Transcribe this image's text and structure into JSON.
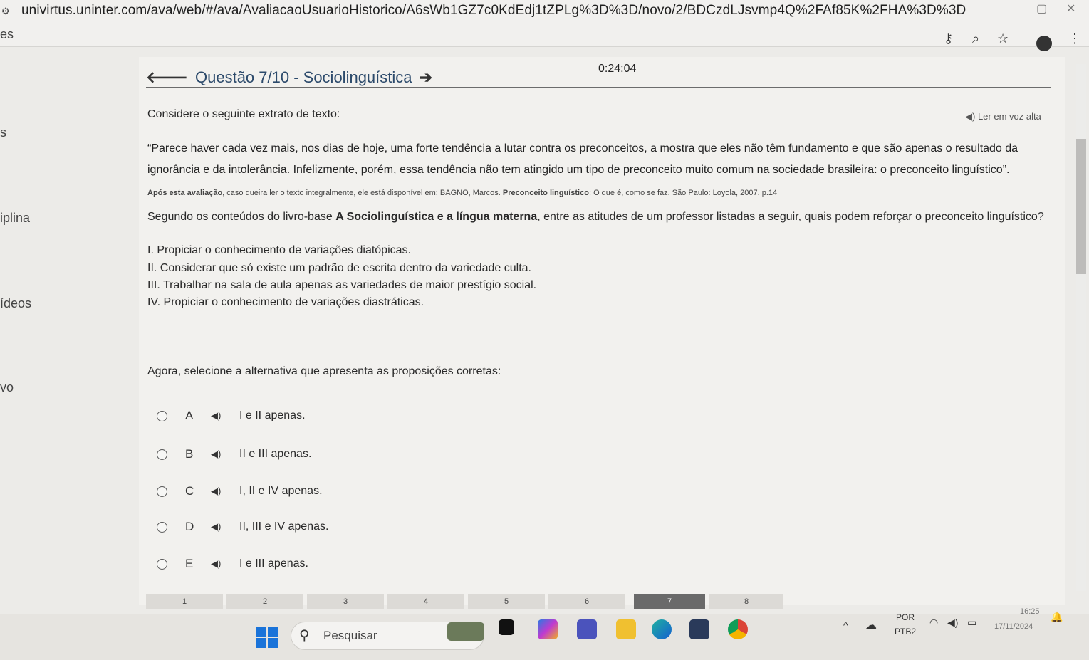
{
  "browser": {
    "url_line1": "univirtus.uninter.com/ava/web/#/ava/AvaliacaoUsuarioHistorico/A6sWb1GZ7c0KdEdj1tZPLg%3D%3D/novo/2/BDCzdLJsvmp4Q%2FAf85K%2FHA%3D%3D",
    "site_icon": "site-settings-icon",
    "toolbar_icons": [
      "password-key-icon",
      "zoom-icon",
      "bookmark-star-icon",
      "profile-avatar",
      "menu-kebab-icon"
    ]
  },
  "sidebar": {
    "fragments": [
      "es",
      "s",
      "iplina",
      "ídeos",
      "vo"
    ]
  },
  "exam": {
    "timer": "0:24:04",
    "title": "Questão 7/10 - Sociolinguística",
    "read_aloud": "Ler em voz alta",
    "prompt": "Considere o seguinte extrato de texto:",
    "quote_line1": "“Parece haver cada vez mais, nos dias de hoje, uma forte tendência a lutar contra os preconceitos, a mostra que eles não têm fundamento e que são apenas o resultado da",
    "quote_line2": "ignorância e da intolerância. Infelizmente, porém, essa tendência não tem atingido um tipo de preconceito muito comum na sociedade brasileira: o preconceito linguístico”.",
    "source_bold": "Após esta avaliação",
    "source_rest": ", caso queira ler o texto integralmente, ele está disponível em:  BAGNO, Marcos. ",
    "source_book": "Preconceito linguístico",
    "source_tail": ": O que é, como se faz. São Paulo: Loyola, 2007. p.14",
    "question_pre": "Segundo os conteúdos do livro-base ",
    "question_book": "A Sociolinguística e a língua materna",
    "question_post": ", entre as atitudes de um professor listadas a seguir, quais podem reforçar o preconceito linguístico?",
    "propositions": [
      "I. Propiciar o conhecimento de variações diatópicas.",
      "II. Considerar que só existe um padrão de escrita dentro da variedade culta.",
      "III. Trabalhar na sala de aula apenas as variedades de maior prestígio social.",
      "IV. Propiciar o conhecimento de variações diastráticas."
    ],
    "instruction": "Agora, selecione a alternativa que apresenta as proposições corretas:",
    "options": [
      {
        "letter": "A",
        "text": "I e II apenas."
      },
      {
        "letter": "B",
        "text": "II e III apenas."
      },
      {
        "letter": "C",
        "text": "I, II e IV apenas."
      },
      {
        "letter": "D",
        "text": "II, III e IV apenas."
      },
      {
        "letter": "E",
        "text": "I e III apenas."
      }
    ],
    "question_nav": [
      "1",
      "2",
      "3",
      "4",
      "5",
      "6",
      "7",
      "8"
    ]
  },
  "taskbar": {
    "search_placeholder": "Pesquisar",
    "lang": "POR",
    "layout": "PTB2",
    "time": "16:25",
    "date": "17/11/2024"
  },
  "colors": {
    "title": "#2c4a6b",
    "windows_blue": "#1a73d9",
    "active_nav": "#6a6a6a"
  }
}
